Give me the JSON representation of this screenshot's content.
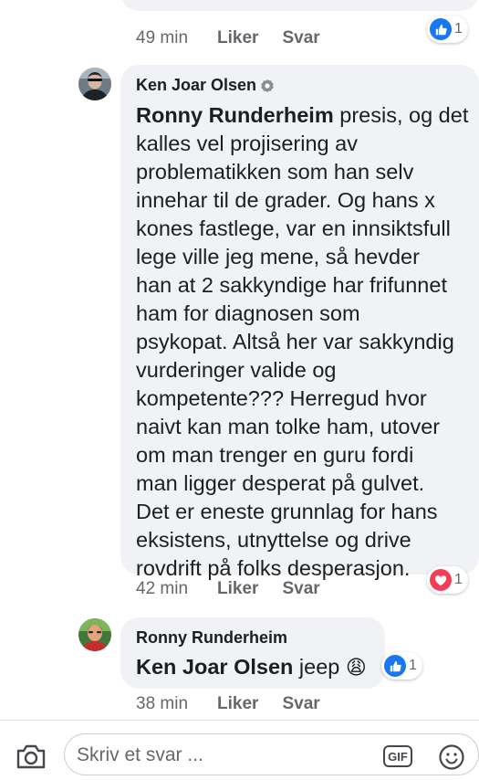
{
  "comments": [
    {
      "author": "",
      "time": "49 min",
      "like_label": "Liker",
      "reply_label": "Svar",
      "reaction_count": "1",
      "reaction_icon": "like-icon"
    },
    {
      "author": "Ken Joar Olsen",
      "mention": "Ronny Runderheim",
      "text_lines": [
        " presis, og det",
        "kalles vel projisering av",
        "problematikken som han selv",
        "innehar til de grader. Og hans x",
        "kones fastlege, var en innsiktsfull",
        "lege ville jeg mene, så hevder",
        "han at 2 sakkyndige har frifunnet",
        "ham for diagnosen som",
        "psykopat. Altså her var sakkyndig",
        "vurderinger valide og",
        "kompetente??? Herregud hvor",
        "naivt kan man tolke ham, utover",
        "om man trenger en guru fordi",
        "man ligger desperat på gulvet.",
        "Det er eneste grunnlag for hans",
        "eksistens, utnyttelse og drive",
        "rovdrift på folks desperasjon."
      ],
      "time": "42 min",
      "like_label": "Liker",
      "reply_label": "Svar",
      "reaction_count": "1",
      "reaction_icon": "love-icon"
    },
    {
      "author": "Ronny Runderheim",
      "mention": "Ken Joar Olsen",
      "text": " jeep ",
      "emoji": "😩",
      "time": "38 min",
      "like_label": "Liker",
      "reply_label": "Svar",
      "reaction_count": "1",
      "reaction_icon": "like-icon"
    }
  ],
  "composer": {
    "placeholder": "Skriv et svar ...",
    "gif_label": "GIF"
  },
  "colors": {
    "like_blue": "#1877f2",
    "love_red": "#f33e58",
    "bubble_gray": "#f0f2f5",
    "meta_gray": "#65676b"
  }
}
